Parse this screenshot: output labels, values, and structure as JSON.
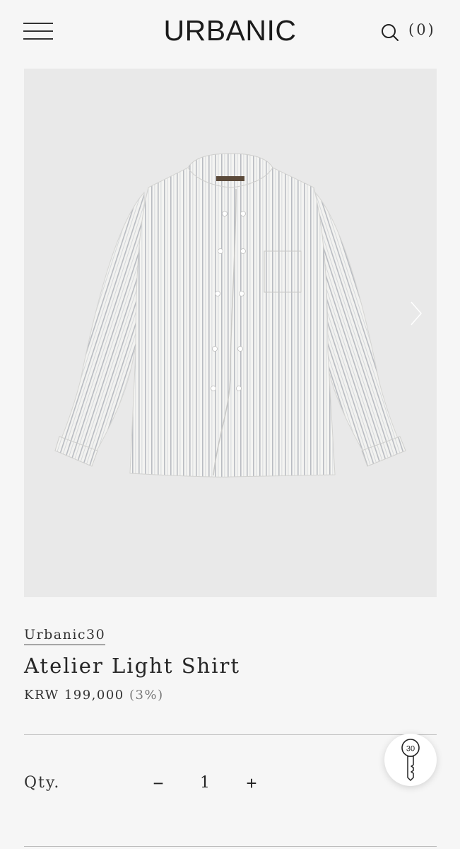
{
  "header": {
    "logo": "URBANIC",
    "cart_count": "(0)",
    "menu_icon": "hamburger-icon",
    "search_icon": "search-icon"
  },
  "gallery": {
    "next_icon": "chevron-right-icon"
  },
  "product": {
    "brand": "Urbanic30",
    "name": "Atelier Light Shirt",
    "price": "KRW 199,000",
    "discount": "(3%)"
  },
  "quantity": {
    "label": "Qty.",
    "minus": "−",
    "value": "1",
    "plus": "+"
  },
  "badge": {
    "number": "30",
    "icon": "key-icon"
  },
  "colors": {
    "background": "#f6f6f6",
    "image_background": "#e9e9e9",
    "text": "#2a2a2a"
  }
}
